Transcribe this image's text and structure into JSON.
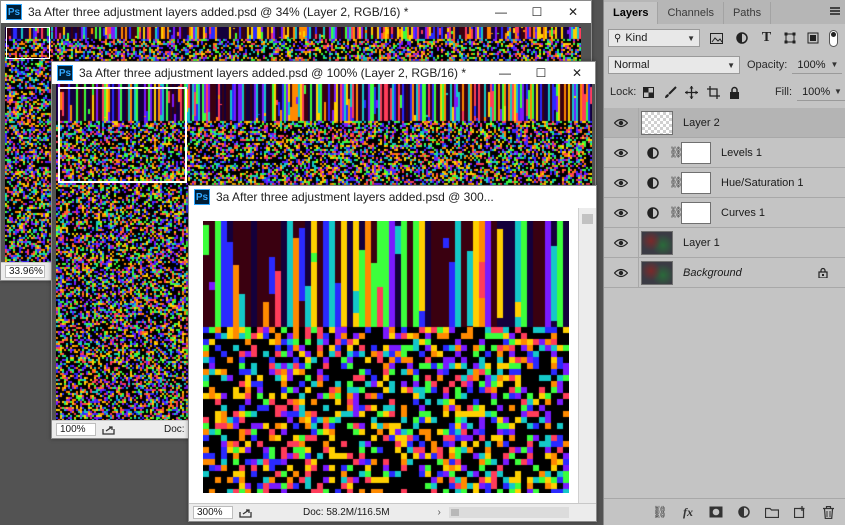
{
  "windows": {
    "back": {
      "title": "3a After three adjustment layers added.psd @ 34% (Layer 2, RGB/16) *",
      "zoom": "33.96%"
    },
    "mid": {
      "title": "3a After three adjustment layers added.psd @ 100% (Layer 2, RGB/16) *",
      "zoom": "100%",
      "doc_label": "Doc:"
    },
    "front": {
      "title": "3a After three adjustment layers added.psd @ 300...",
      "zoom": "300%",
      "doc_info": "Doc: 58.2M/116.5M"
    }
  },
  "panel": {
    "tabs": [
      "Layers",
      "Channels",
      "Paths"
    ],
    "filter_kind": "Kind",
    "blend_mode": "Normal",
    "opacity_label": "Opacity:",
    "opacity_value": "100%",
    "lock_label": "Lock:",
    "fill_label": "Fill:",
    "fill_value": "100%",
    "layers": [
      {
        "name": "Layer 2",
        "type": "empty",
        "selected": true
      },
      {
        "name": "Levels 1",
        "type": "adjustment"
      },
      {
        "name": "Hue/Saturation 1",
        "type": "adjustment"
      },
      {
        "name": "Curves 1",
        "type": "adjustment"
      },
      {
        "name": "Layer 1",
        "type": "image"
      },
      {
        "name": "Background",
        "type": "background"
      }
    ]
  },
  "colors": {
    "panel_bg": "#c4c4c4",
    "workspace": "#535353",
    "selected_row": "#b4b4b4"
  }
}
